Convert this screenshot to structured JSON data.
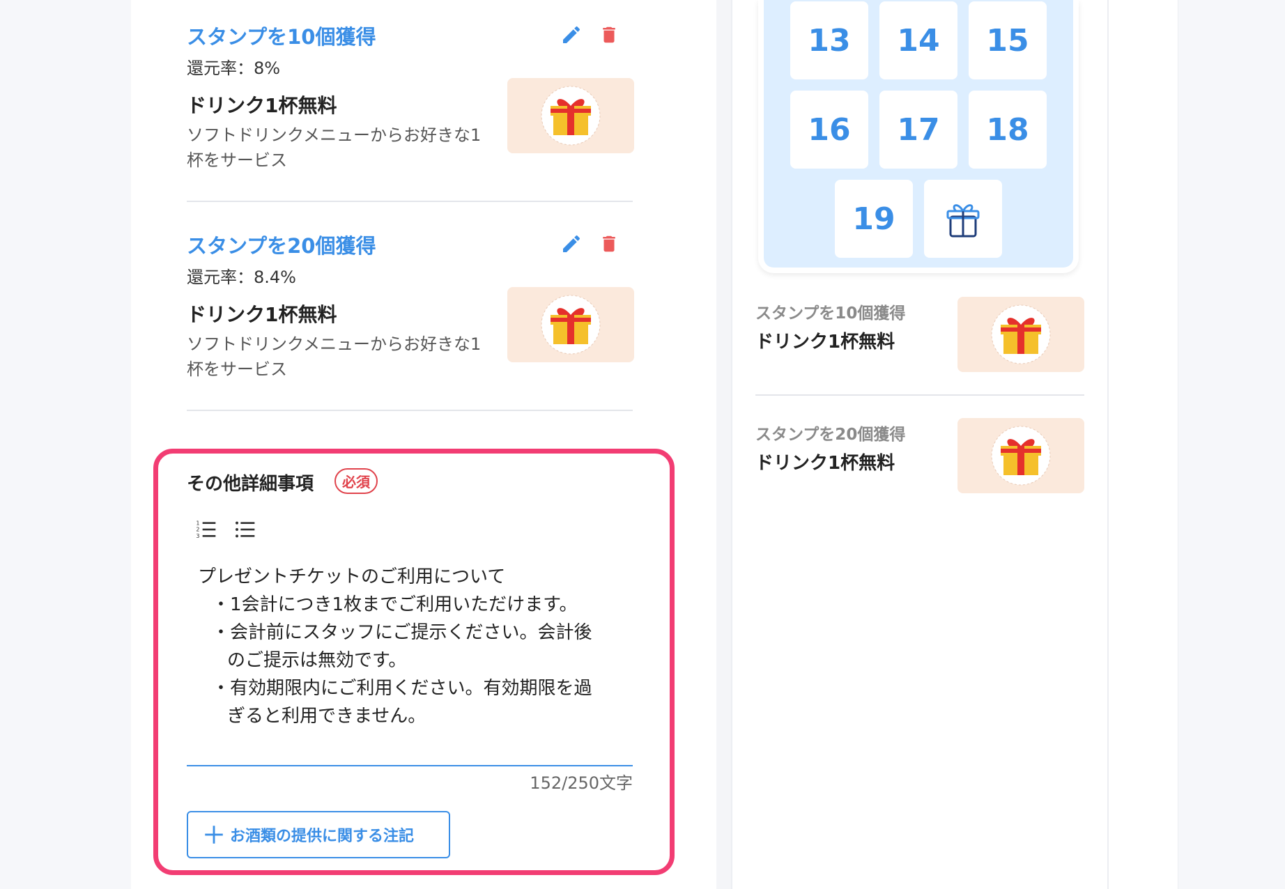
{
  "rewards": [
    {
      "title": "スタンプを10個獲得",
      "rate": "還元率：8%",
      "name": "ドリンク1杯無料",
      "desc": "ソフトドリンクメニューからお好きな1杯をサービス"
    },
    {
      "title": "スタンプを20個獲得",
      "rate": "還元率：8.4%",
      "name": "ドリンク1杯無料",
      "desc": "ソフトドリンクメニューからお好きな1杯をサービス"
    }
  ],
  "details": {
    "label": "その他詳細事項",
    "required_badge": "必須",
    "text_lines": [
      "プレゼントチケットのご利用について",
      "・1会計につき1枚までご利用いただけます。",
      "・会計前にスタッフにご提示ください。会計後",
      "のご提示は無効です。",
      "・有効期限内にご利用ください。有効期限を過",
      "ぎると利用できません。"
    ],
    "counter": "152/250文字",
    "add_button": "お酒類の提供に関する注記"
  },
  "preview": {
    "stamps": [
      "13",
      "14",
      "15",
      "16",
      "17",
      "18",
      "19"
    ],
    "rewards": [
      {
        "title": "スタンプを10個獲得",
        "name": "ドリンク1杯無料"
      },
      {
        "title": "スタンプを20個獲得",
        "name": "ドリンク1杯無料"
      }
    ]
  },
  "icons": {
    "edit": "pencil-icon",
    "delete": "trash-icon",
    "ordered_list": "ordered-list-icon",
    "bullet_list": "bullet-list-icon",
    "add": "plus-icon",
    "gift": "gift-icon"
  },
  "colors": {
    "accent": "#3a8ee6",
    "danger": "#e0424b",
    "highlight": "#f23d73",
    "stamp_card_bg": "#ddeeff"
  }
}
